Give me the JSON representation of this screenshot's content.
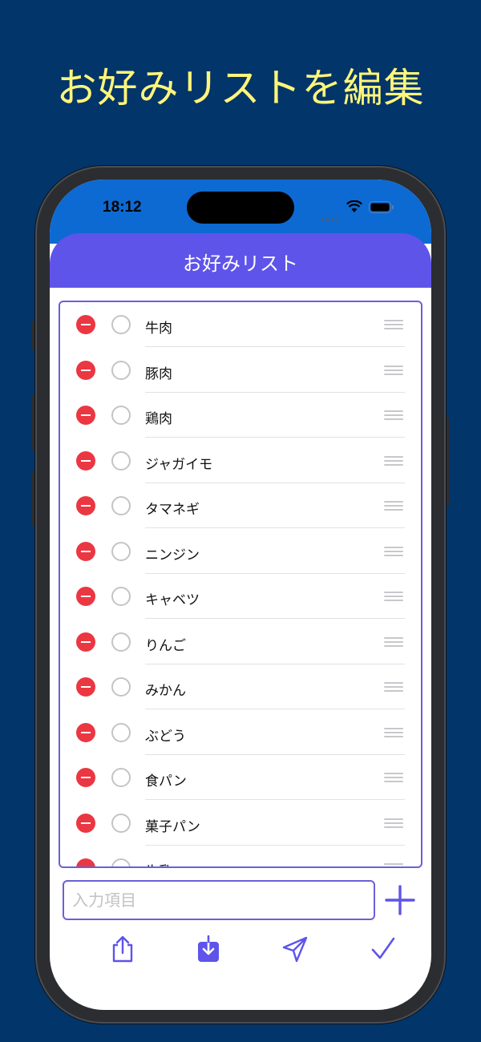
{
  "promo": {
    "title": "お好みリストを編集"
  },
  "status_bar": {
    "time": "18:12"
  },
  "header": {
    "title": "お好みリスト"
  },
  "list": {
    "items": [
      {
        "label": "牛肉"
      },
      {
        "label": "豚肉"
      },
      {
        "label": "鶏肉"
      },
      {
        "label": "ジャガイモ"
      },
      {
        "label": "タマネギ"
      },
      {
        "label": "ニンジン"
      },
      {
        "label": "キャベツ"
      },
      {
        "label": "りんご"
      },
      {
        "label": "みかん"
      },
      {
        "label": "ぶどう"
      },
      {
        "label": "食パン"
      },
      {
        "label": "菓子パン"
      },
      {
        "label": "牛乳"
      }
    ]
  },
  "input": {
    "placeholder": "入力項目",
    "value": ""
  },
  "toolbar": {
    "icons": [
      "share-icon",
      "download-icon",
      "send-icon",
      "checkmark-icon"
    ]
  },
  "colors": {
    "background": "#02356a",
    "promo_text": "#fff67a",
    "status_bar": "#0d6ad2",
    "header": "#5e54ea",
    "accent": "#6b5fd6",
    "delete": "#eb3742"
  }
}
